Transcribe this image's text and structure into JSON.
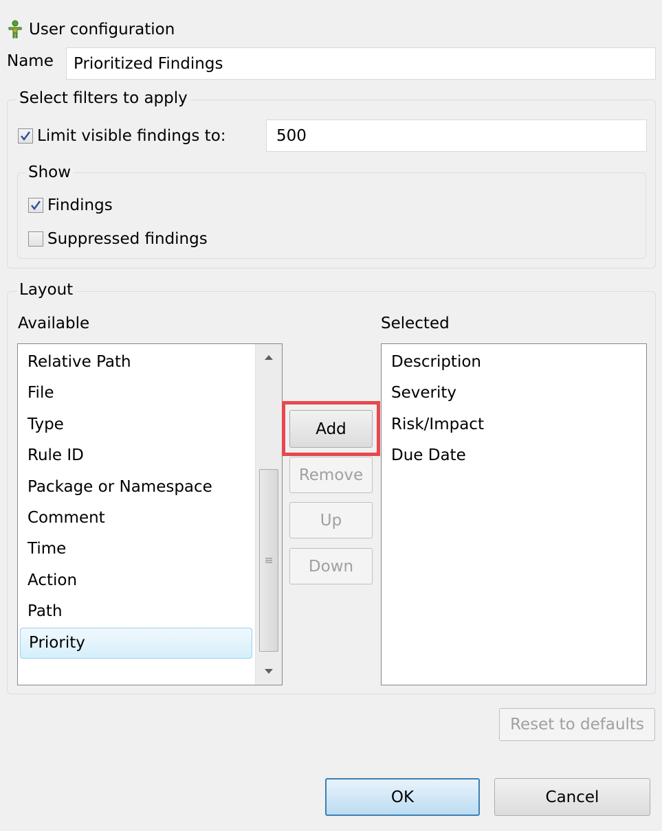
{
  "dialog": {
    "title": "User configuration",
    "icon": "user-config-icon"
  },
  "name_field": {
    "label": "Name",
    "value": "Prioritized Findings"
  },
  "filters": {
    "legend": "Select filters to apply",
    "limit": {
      "label": "Limit visible findings to:",
      "checked": true,
      "value": "500"
    },
    "show": {
      "legend": "Show",
      "findings_label": "Findings",
      "findings_checked": true,
      "suppressed_label": "Suppressed findings",
      "suppressed_checked": false
    }
  },
  "layout": {
    "legend": "Layout",
    "available_label": "Available",
    "selected_label": "Selected",
    "available_items": [
      "Relative Path",
      "File",
      "Type",
      "Rule ID",
      "Package or Namespace",
      "Comment",
      "Time",
      "Action",
      "Path",
      "Priority"
    ],
    "selected_available": "Priority",
    "selected_items": [
      "Description",
      "Severity",
      "Risk/Impact",
      "Due Date"
    ],
    "buttons": {
      "add": "Add",
      "remove": "Remove",
      "up": "Up",
      "down": "Down"
    },
    "highlight_color": "#e8474e"
  },
  "footer": {
    "reset": "Reset to defaults",
    "ok": "OK",
    "cancel": "Cancel"
  }
}
